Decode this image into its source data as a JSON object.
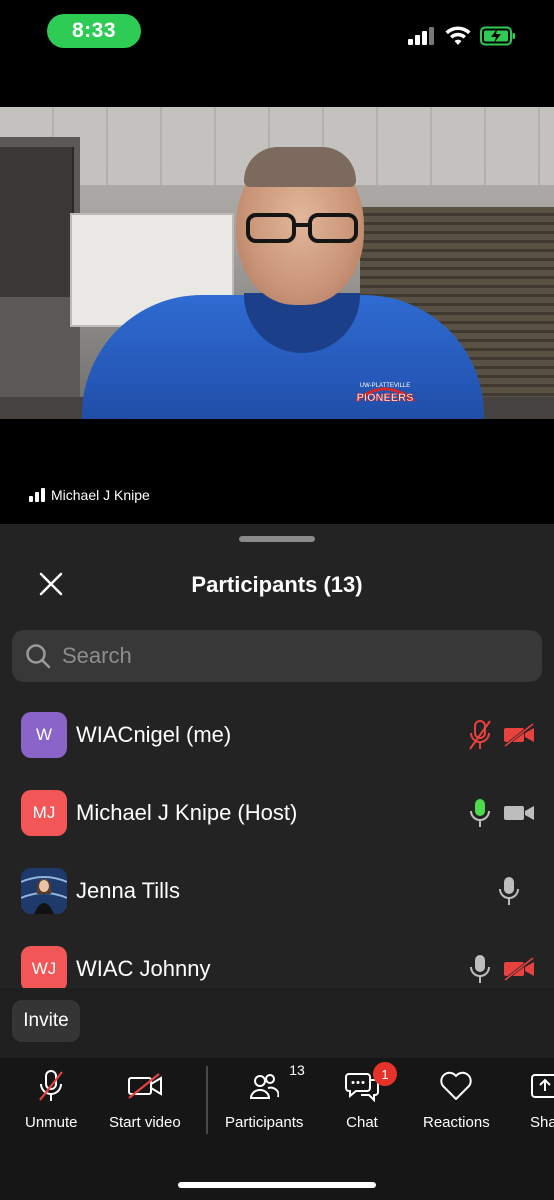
{
  "status_bar": {
    "time": "8:33",
    "accent_color": "#2ecc55",
    "icons": [
      "cellular-signal-icon",
      "wifi-icon",
      "battery-charging-icon"
    ]
  },
  "video": {
    "speaker_name": "Michael J Knipe",
    "shirt_text": "PIONEERS",
    "shirt_subtext": "UW-PLATTEVILLE"
  },
  "panel": {
    "title": "Participants (13)",
    "search_placeholder": "Search",
    "participants": [
      {
        "initials": "W",
        "avatar_color": "#8a64c9",
        "name": "WIACnigel (me)",
        "mic": "muted",
        "video": "off"
      },
      {
        "initials": "MJ",
        "avatar_color": "#f25656",
        "name": "Michael J Knipe (Host)",
        "mic": "speaking",
        "video": "on"
      },
      {
        "initials": "",
        "avatar_color": "#1e3a6b",
        "name": "Jenna Tills",
        "mic": "unmuted",
        "video": "none"
      },
      {
        "initials": "WJ",
        "avatar_color": "#f25656",
        "name": "WIAC Johnny",
        "mic": "unmuted",
        "video": "off"
      }
    ],
    "invite_label": "Invite"
  },
  "toolbar": {
    "unmute": "Unmute",
    "start_video": "Start video",
    "participants": "Participants",
    "participants_count": "13",
    "chat": "Chat",
    "chat_badge": "1",
    "reactions": "Reactions",
    "share": "Share"
  }
}
